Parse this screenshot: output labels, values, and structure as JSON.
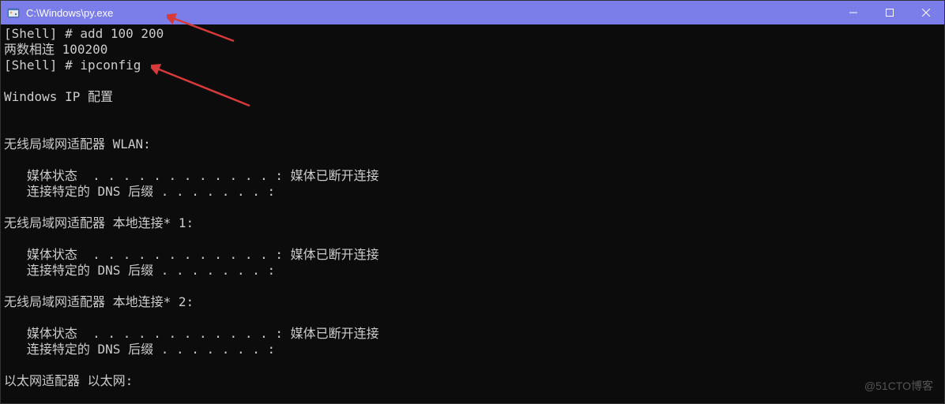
{
  "titlebar": {
    "title": "C:\\Windows\\py.exe"
  },
  "terminal": {
    "content": "[Shell] # add 100 200\n两数相连 100200\n[Shell] # ipconfig\n\nWindows IP 配置\n\n\n无线局域网适配器 WLAN:\n\n   媒体状态  . . . . . . . . . . . . : 媒体已断开连接\n   连接特定的 DNS 后缀 . . . . . . . :\n\n无线局域网适配器 本地连接* 1:\n\n   媒体状态  . . . . . . . . . . . . : 媒体已断开连接\n   连接特定的 DNS 后缀 . . . . . . . :\n\n无线局域网适配器 本地连接* 2:\n\n   媒体状态  . . . . . . . . . . . . : 媒体已断开连接\n   连接特定的 DNS 后缀 . . . . . . . :\n\n以太网适配器 以太网:"
  },
  "watermark": "@51CTO博客"
}
